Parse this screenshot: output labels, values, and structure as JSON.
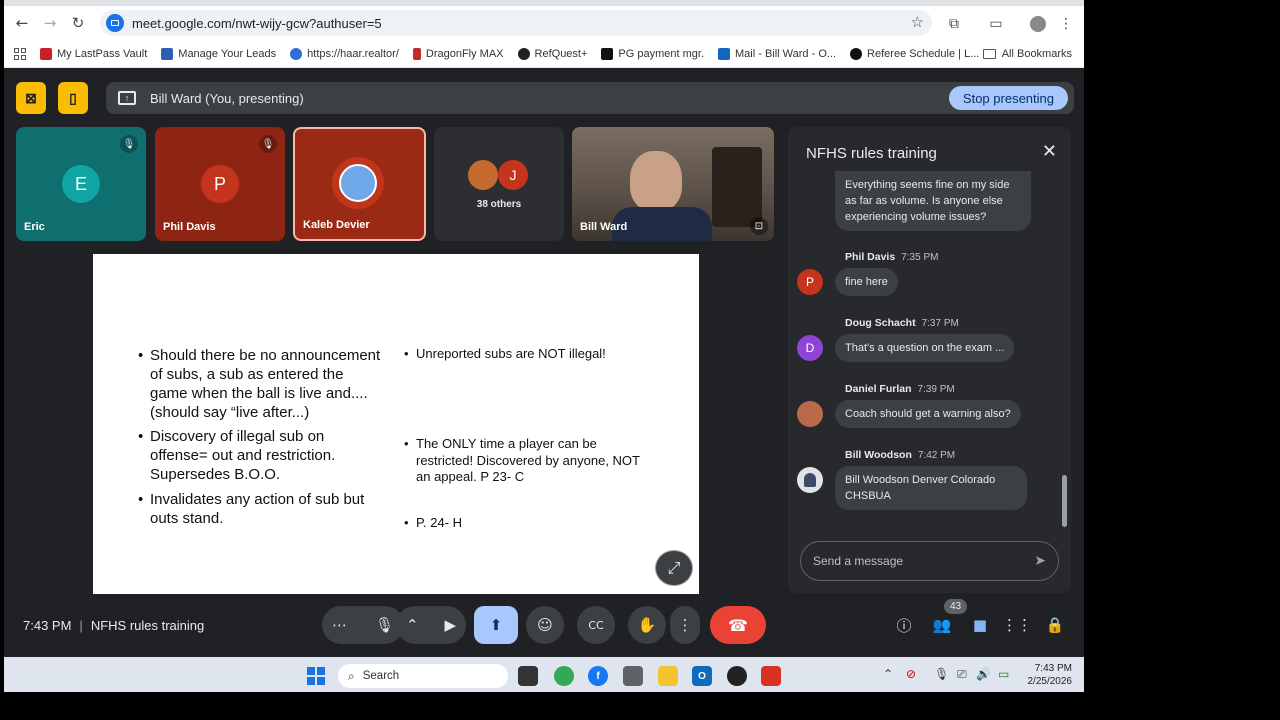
{
  "browser": {
    "url": "meet.google.com/nwt-wijy-gcw?authuser=5",
    "bookmarks": [
      "My LastPass Vault",
      "Manage Your Leads",
      "https://haar.realtor/",
      "DragonFly MAX",
      "RefQuest+",
      "PG payment mgr.",
      "Mail - Bill Ward - O...",
      "Referee Schedule | L..."
    ],
    "all_bookmarks": "All Bookmarks"
  },
  "presenting": {
    "text": "Bill Ward (You, presenting)",
    "stop_label": "Stop presenting"
  },
  "tiles": [
    {
      "name": "Eric",
      "initial": "E",
      "color": "#12a4a4"
    },
    {
      "name": "Phil Davis",
      "initial": "P",
      "color": "#c5341c"
    },
    {
      "name": "Kaleb Devier"
    },
    {
      "label": "38 others",
      "initial": "J"
    },
    {
      "name": "Bill Ward"
    }
  ],
  "slide": {
    "left": [
      "Should there be no announcement of subs, a sub as entered the game when the ball is live and....(should say “live after...)",
      "Discovery of illegal sub on offense= out and restriction. Supersedes B.O.O.",
      "Invalidates any action of sub but outs stand."
    ],
    "right_top": "Unreported subs are NOT illegal!",
    "right_mid": "The ONLY time a player can be restricted!  Discovered by anyone, NOT an appeal.  P 23- C",
    "right_bottom": "P. 24- H"
  },
  "chat": {
    "title": "NFHS rules training",
    "messages": [
      {
        "text": "Everything seems fine on my side as far as volume. Is anyone else experiencing volume issues?"
      },
      {
        "sender": "Phil Davis",
        "time": "7:35 PM",
        "text": "fine here",
        "initial": "P",
        "color": "#c5341c"
      },
      {
        "sender": "Doug Schacht",
        "time": "7:37 PM",
        "text": "That's a question on the exam ...",
        "initial": "D",
        "color": "#8e44d4"
      },
      {
        "sender": "Daniel Furlan",
        "time": "7:39 PM",
        "text": "Coach should get a warning also?"
      },
      {
        "sender": "Bill Woodson",
        "time": "7:42 PM",
        "text": "Bill Woodson Denver Colorado CHSBUA"
      }
    ],
    "input_placeholder": "Send a message"
  },
  "bottom": {
    "time": "7:43 PM",
    "sep": "|",
    "meeting": "NFHS rules training",
    "people_count": "43"
  },
  "taskbar": {
    "search": "Search",
    "time": "7:43 PM",
    "date": "2/25/2026"
  }
}
